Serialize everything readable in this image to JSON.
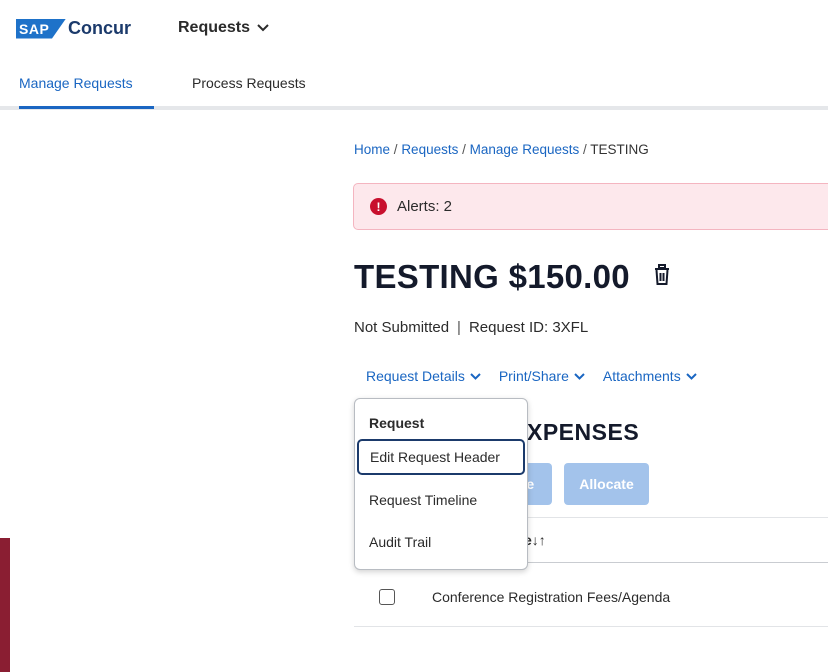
{
  "header": {
    "logo_badge": "SAP",
    "logo_text": "Concur",
    "app_menu_label": "Requests"
  },
  "tabs": [
    {
      "label": "Manage Requests",
      "active": true
    },
    {
      "label": "Process Requests",
      "active": false
    }
  ],
  "breadcrumb": {
    "items": [
      "Home",
      "Requests",
      "Manage Requests"
    ],
    "separator": "/",
    "current": "TESTING"
  },
  "alert": {
    "text": "Alerts: 2"
  },
  "request": {
    "title": "TESTING $150.00",
    "status": "Not Submitted",
    "id_text": "Request ID: 3XFL"
  },
  "actions": [
    {
      "label": "Request Details"
    },
    {
      "label": "Print/Share"
    },
    {
      "label": "Attachments"
    }
  ],
  "section": {
    "heading_visible": "XPENSES"
  },
  "toolbar": {
    "partial_button_visible": "te",
    "allocate_label": "Allocate"
  },
  "table": {
    "header_visible": "e",
    "rows": [
      {
        "label": "Conference Registration Fees/Agenda"
      }
    ]
  },
  "dropdown": {
    "group_label": "Request",
    "items": [
      {
        "label": "Edit Request Header",
        "focused": true
      },
      {
        "label": "Request Timeline",
        "focused": false
      },
      {
        "label": "Audit Trail",
        "focused": false
      }
    ]
  },
  "colors": {
    "brand_blue": "#1a66c2",
    "alert_red": "#c8102e",
    "disabled_button": "#a3c3eb"
  }
}
